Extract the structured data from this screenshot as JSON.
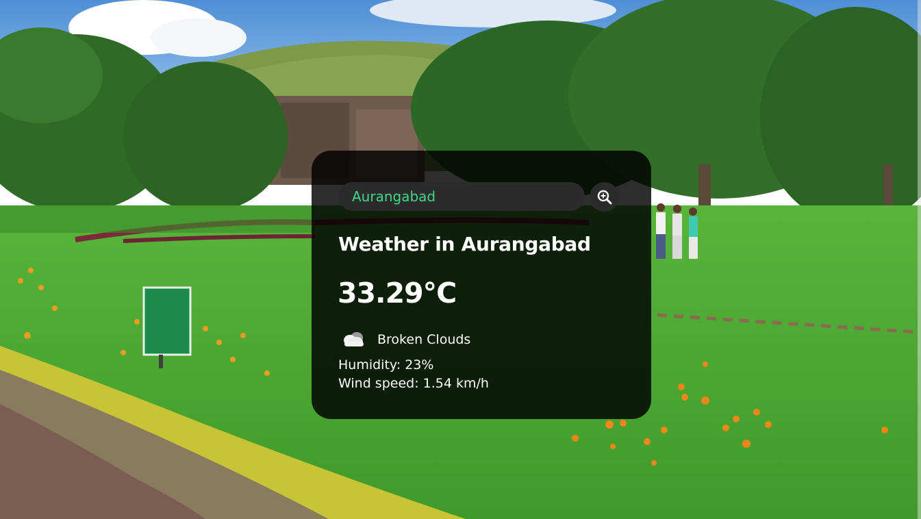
{
  "search": {
    "value": "Aurangabad",
    "placeholder": "Search"
  },
  "weather": {
    "title": "Weather in Aurangabad",
    "temperature": "33.29°C",
    "description": "Broken Clouds",
    "icon": "broken-clouds-icon",
    "humidity": "Humidity: 23%",
    "wind": "Wind speed: 1.54 km/h"
  },
  "colors": {
    "card_background": "#000000",
    "input_background": "#2b2b2b",
    "input_text": "#40d98a",
    "text": "#ffffff"
  },
  "background": {
    "scene": "park-landscape-with-rock-cut-caves"
  }
}
